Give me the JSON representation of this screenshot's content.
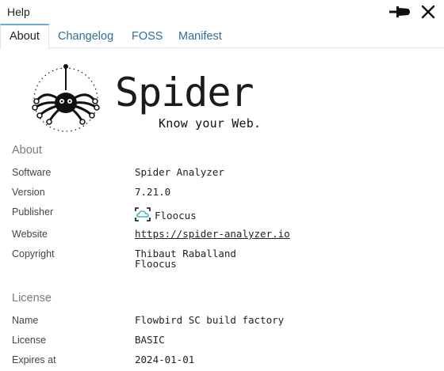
{
  "window": {
    "title": "Help",
    "pin_icon": "pin-icon",
    "close_icon": "close-icon"
  },
  "tabs": [
    {
      "label": "About",
      "active": true
    },
    {
      "label": "Changelog",
      "active": false
    },
    {
      "label": "FOSS",
      "active": false
    },
    {
      "label": "Manifest",
      "active": false
    }
  ],
  "branding": {
    "logo_icon": "spider-logo-icon",
    "name": "Spider",
    "tagline": "Know your Web."
  },
  "about": {
    "heading": "About",
    "rows": {
      "software": {
        "label": "Software",
        "value": "Spider Analyzer"
      },
      "version": {
        "label": "Version",
        "value": "7.21.0"
      },
      "publisher": {
        "label": "Publisher",
        "value": "Floocus",
        "icon": "cloud-icon"
      },
      "website": {
        "label": "Website",
        "value": "https://spider-analyzer.io"
      },
      "copyright": {
        "label": "Copyright",
        "value_line1": "Thibaut Raballand",
        "value_line2": "Floocus"
      }
    }
  },
  "license": {
    "heading": "License",
    "rows": {
      "name": {
        "label": "Name",
        "value": "Flowbird SC build factory"
      },
      "license": {
        "label": "License",
        "value": "BASIC"
      },
      "expires": {
        "label": "Expires at",
        "value": "2024-01-01"
      }
    }
  },
  "colors": {
    "tab_link": "#2f6e9a",
    "tab_active_border": "#6aaad0",
    "publisher_icon": "#3fb6d6"
  }
}
